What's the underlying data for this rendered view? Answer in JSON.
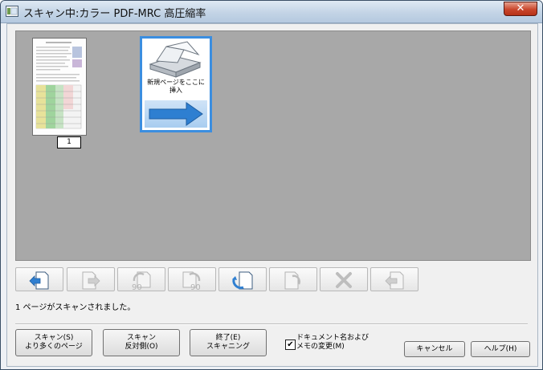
{
  "window": {
    "title": "スキャン中:カラー PDF-MRC 高圧縮率",
    "close_glyph": "✕"
  },
  "viewer": {
    "page_number": "1",
    "insert_label_line1": "新規ページをここに",
    "insert_label_line2": "挿入"
  },
  "toolbar": {
    "buttons": [
      {
        "icon": "insert-before-icon",
        "enabled": true
      },
      {
        "icon": "insert-after-icon",
        "enabled": false
      },
      {
        "icon": "rotate-left-90-icon",
        "enabled": false,
        "text": "90"
      },
      {
        "icon": "rotate-right-90-icon",
        "enabled": false,
        "text": "90"
      },
      {
        "icon": "rotate-180-icon",
        "enabled": true
      },
      {
        "icon": "flip-icon",
        "enabled": false
      },
      {
        "icon": "delete-icon",
        "enabled": false
      },
      {
        "icon": "move-icon",
        "enabled": false
      }
    ]
  },
  "status": {
    "text": "1 ページがスキャンされました。"
  },
  "buttons": {
    "scan_more_line1": "スキャン(S)",
    "scan_more_line2": "より多くのページ",
    "scan_reverse_line1": "スキャン",
    "scan_reverse_line2": "反対側(O)",
    "finish_line1": "終了(E)",
    "finish_line2": "スキャニング",
    "cancel": "キャンセル",
    "help": "ヘルプ(H)"
  },
  "checkbox": {
    "checked": true,
    "mark": "✔",
    "label_line1": "ドキュメント名および",
    "label_line2": "メモの変更(M)"
  }
}
